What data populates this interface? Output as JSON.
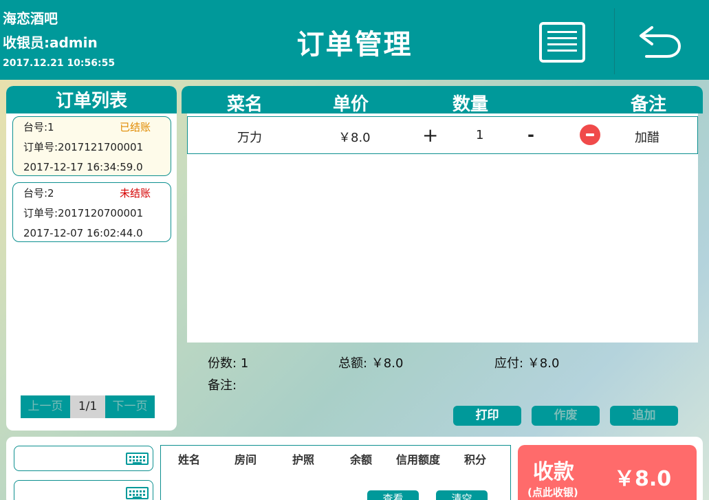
{
  "header": {
    "store_name": "海恋酒吧",
    "cashier": "收银员:admin",
    "datetime": "2017.12.21 10:56:55",
    "title": "订单管理",
    "menu_icon": "menu-list-icon",
    "back_icon": "back-arrow-icon"
  },
  "order_list": {
    "title": "订单列表",
    "orders": [
      {
        "table": "台号:1",
        "status": "已结账",
        "status_color": "#e08a00",
        "order_no": "订单号:2017121700001",
        "time": "2017-12-17 16:34:59.0",
        "bg": "#fefbea"
      },
      {
        "table": "台号:2",
        "status": "未结账",
        "status_color": "#d40000",
        "order_no": "订单号:2017120700001",
        "time": "2017-12-07 16:02:44.0",
        "bg": "#ffffff"
      }
    ],
    "pager": {
      "prev": "上一页",
      "page": "1/1",
      "next": "下一页"
    }
  },
  "order_detail": {
    "headers": {
      "name": "菜名",
      "price": "单价",
      "qty": "数量",
      "note": "备注"
    },
    "items": [
      {
        "name": "万力",
        "price": "￥8.0",
        "plus": "+",
        "qty": "1",
        "minus": "-",
        "note": "加醋"
      }
    ],
    "summary": {
      "count_label": "份数:",
      "count": "1",
      "total_label": "总额:",
      "total": "￥8.0",
      "payable_label": "应付:",
      "payable": "￥8.0",
      "note_label": "备注:"
    },
    "buttons": {
      "print": "打印",
      "void": "作废",
      "add": "追加"
    }
  },
  "guest_panel": {
    "headers": [
      "姓名",
      "房间",
      "护照",
      "余额",
      "信用额度",
      "积分"
    ],
    "view_label": "查看",
    "clear_label": "清空"
  },
  "pay": {
    "label": "收款",
    "hint": "(点此收银)",
    "amount": "￥8.0"
  },
  "colors": {
    "teal": "#00999a",
    "pay_red": "#ff6b6b",
    "minus_red": "#f04a4a"
  }
}
